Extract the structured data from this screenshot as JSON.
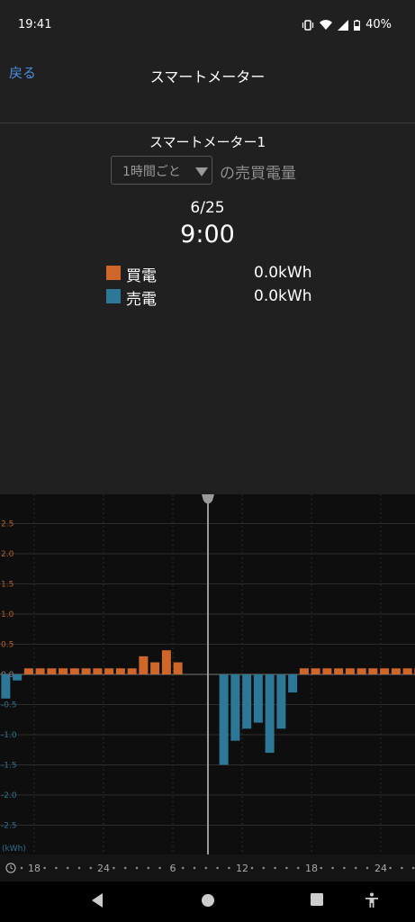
{
  "status_bar": {
    "time": "19:41",
    "battery": "40%",
    "icons": [
      "vibrate-icon",
      "wifi-icon",
      "signal-icon",
      "battery-icon"
    ]
  },
  "nav": {
    "back_label": "戻る",
    "title": "スマートメーター"
  },
  "meter": {
    "name": "スマートメーター1",
    "interval_select": "1時間ごと",
    "interval_suffix": "の売買電量",
    "date": "6/25",
    "time": "9:00"
  },
  "legend": [
    {
      "name": "買電",
      "value": "0.0kWh",
      "color": "#d0672a"
    },
    {
      "name": "売電",
      "value": "0.0kWh",
      "color": "#2d7896"
    }
  ],
  "chart_data": {
    "type": "bar",
    "unit_label": "(kWh)",
    "ylim": [
      -3.0,
      3.0
    ],
    "yticks": [
      "2.5",
      "2.0",
      "1.5",
      "1.0",
      "0.5",
      "0.0",
      "-0.5",
      "-1.0",
      "-1.5",
      "-2.0",
      "-2.5"
    ],
    "selected_hour": "9:00",
    "series": [
      {
        "name": "買電",
        "color": "#d0672a",
        "values": [
          0,
          0,
          0.1,
          0.1,
          0.1,
          0.1,
          0.1,
          0.1,
          0.1,
          0.1,
          0.1,
          0.1,
          0.3,
          0.2,
          0.4,
          0.2,
          0,
          0,
          0,
          0,
          0,
          0,
          0,
          0,
          0,
          0,
          0.1,
          0.1,
          0.1,
          0.1,
          0.1,
          0.1,
          0.1,
          0.1,
          0.1,
          0.1,
          0.1,
          0.1
        ]
      },
      {
        "name": "売電",
        "color": "#2d7896",
        "values": [
          0.4,
          0.1,
          0,
          0,
          0,
          0,
          0,
          0,
          0,
          0,
          0,
          0,
          0,
          0,
          0,
          0,
          0,
          0,
          0,
          1.5,
          1.1,
          0.9,
          0.8,
          1.3,
          0.9,
          0.3,
          0,
          0,
          0,
          0,
          0,
          0,
          0,
          0,
          0,
          0,
          0,
          0
        ]
      }
    ],
    "x_tick_labels": [
      "18",
      "24",
      "6",
      "12",
      "18",
      "24"
    ],
    "grid": true,
    "legend": "top"
  },
  "sysnav": {
    "buttons": [
      "back-icon",
      "home-icon",
      "recents-icon",
      "accessibility-icon"
    ]
  }
}
